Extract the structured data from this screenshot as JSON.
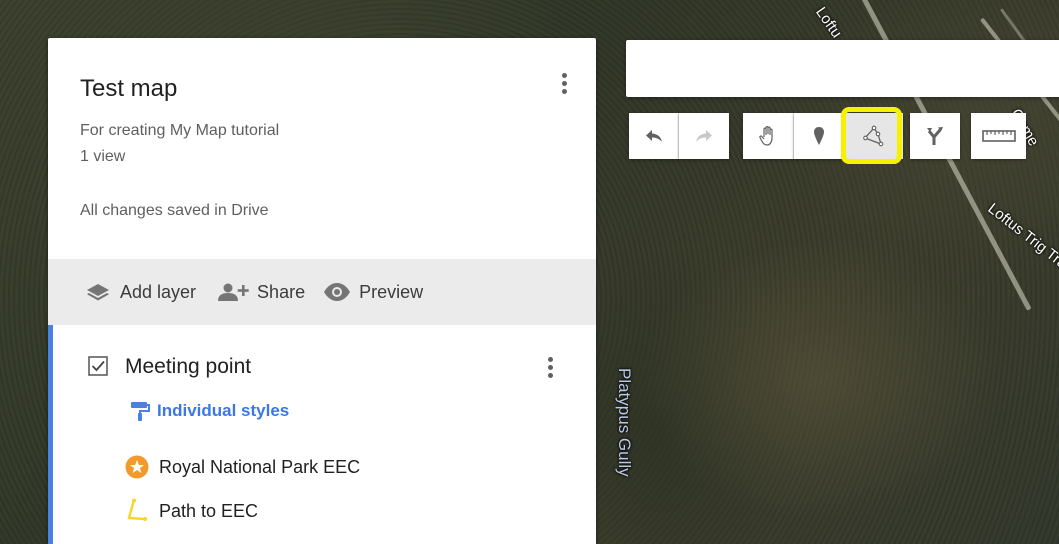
{
  "map": {
    "labels": {
      "loftus_top": "Loftu",
      "cameron": "Came",
      "loftus_trig": "Loftus Trig Tra",
      "platypus_gully": "Platypus Gully"
    }
  },
  "panel": {
    "title": "Test map",
    "description": "For creating My Map tutorial",
    "views": "1 view",
    "save_status": "All changes saved in Drive",
    "actions": {
      "add_layer": "Add layer",
      "share": "Share",
      "preview": "Preview"
    },
    "layer": {
      "name": "Meeting point",
      "checked": true,
      "style_label": "Individual styles",
      "features": [
        {
          "label": "Royal National Park EEC",
          "icon": "star-marker-icon"
        },
        {
          "label": "Path to EEC",
          "icon": "path-line-icon"
        }
      ]
    }
  },
  "search": {
    "value": "",
    "placeholder": ""
  },
  "toolbar": {
    "buttons": [
      "undo-icon",
      "redo-icon",
      "hand-icon",
      "marker-icon",
      "draw-line-icon",
      "directions-icon",
      "ruler-icon"
    ],
    "selected": "draw-line-icon",
    "highlight_color": "#f5f200"
  },
  "colors": {
    "accent_blue": "#4a80e0",
    "style_link": "#3b78e7",
    "star_marker": "#f29b2c",
    "path_line": "#f7d52a"
  }
}
